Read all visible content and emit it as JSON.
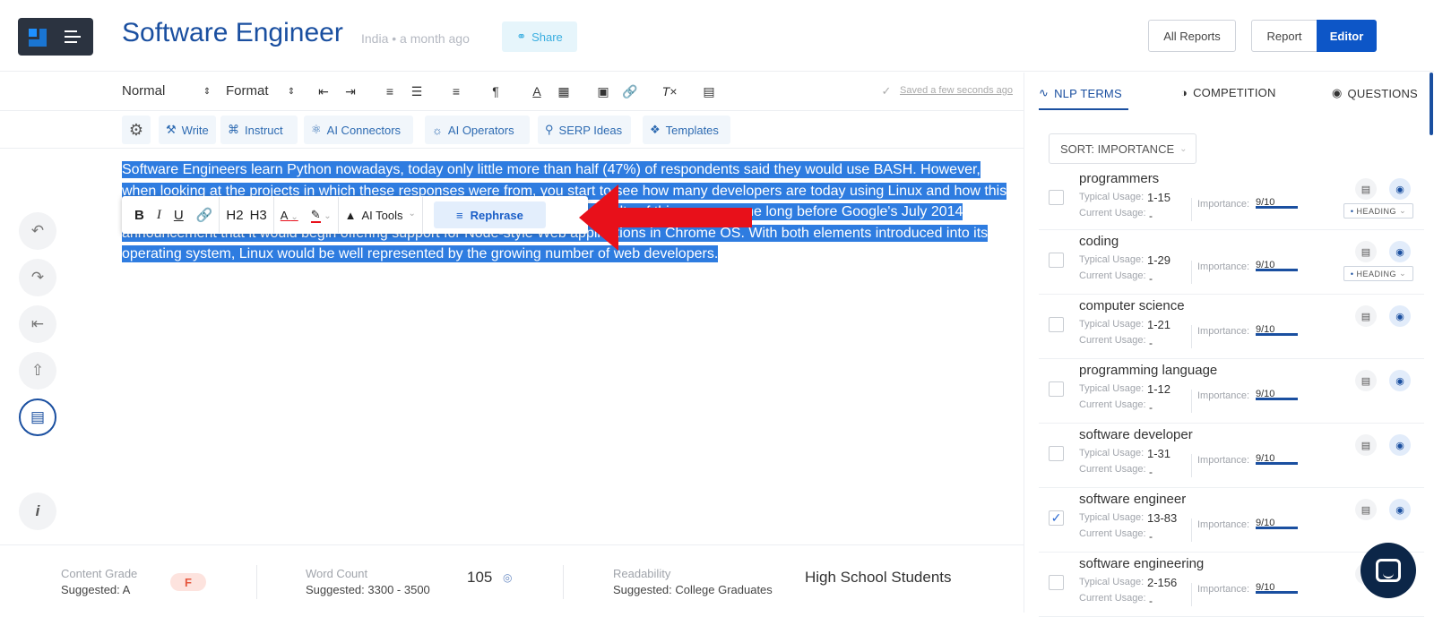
{
  "header": {
    "title": "Software Engineer",
    "meta": "India • a month ago",
    "share_label": "Share",
    "all_reports_label": "All Reports",
    "report_label": "Report",
    "editor_label": "Editor"
  },
  "toolbar": {
    "style_select": "Normal",
    "format_select": "Format",
    "saved_text": "Saved a few seconds ago"
  },
  "ai_toolbar": {
    "write": "Write",
    "instruct": "Instruct",
    "connectors": "AI Connectors",
    "operators": "AI Operators",
    "serp": "SERP Ideas",
    "templates": "Templates"
  },
  "editor": {
    "paragraph": "Software Engineers learn Python nowadays, today only little more than half (47%) of respondents said they would use BASH. However, when looking at the projects in which these responses were from, you start to see how many developers are today using Linux and how this number has been going up continually (26% last year and now 29%). The results of this survey come long before Google's July 2014 announcement that it would begin offering support for Node-style Web applications in Chrome OS. With both elements introduced into its operating system, Linux would be well represented by the growing number of web developers."
  },
  "format_popup": {
    "h2": "H2",
    "h3": "H3",
    "ai_tools": "AI Tools",
    "rephrase": "Rephrase"
  },
  "bottom_bar": {
    "grade_label": "Content Grade",
    "grade_suggested": "Suggested: A",
    "grade_value": "F",
    "wc_label": "Word Count",
    "wc_suggested": "Suggested: 3300 - 3500",
    "wc_value": "105",
    "read_label": "Readability",
    "read_suggested": "Suggested: College Graduates",
    "read_value": "High School Students"
  },
  "right_panel": {
    "tabs": [
      "NLP TERMS",
      "COMPETITION",
      "QUESTIONS"
    ],
    "sort_label": "SORT: IMPORTANCE",
    "typical_label": "Typical Usage:",
    "current_label": "Current Usage:",
    "importance_label": "Importance:",
    "heading_badge": "HEADING",
    "terms": [
      {
        "name": "programmers",
        "typical": "1-15",
        "current": "-",
        "importance": "9/10",
        "checked": false
      },
      {
        "name": "coding",
        "typical": "1-29",
        "current": "-",
        "importance": "9/10",
        "checked": false
      },
      {
        "name": "computer science",
        "typical": "1-21",
        "current": "-",
        "importance": "9/10",
        "checked": false
      },
      {
        "name": "programming language",
        "typical": "1-12",
        "current": "-",
        "importance": "9/10",
        "checked": false
      },
      {
        "name": "software developer",
        "typical": "1-31",
        "current": "-",
        "importance": "9/10",
        "checked": false
      },
      {
        "name": "software engineer",
        "typical": "13-83",
        "current": "-",
        "importance": "9/10",
        "checked": true
      },
      {
        "name": "software engineering",
        "typical": "2-156",
        "current": "-",
        "importance": "9/10",
        "checked": false
      }
    ]
  },
  "colors": {
    "brand_blue": "#1a4fa0",
    "editor_blue": "#0d56c7",
    "selection": "#2e7ce0",
    "arrow_red": "#e8101a"
  }
}
